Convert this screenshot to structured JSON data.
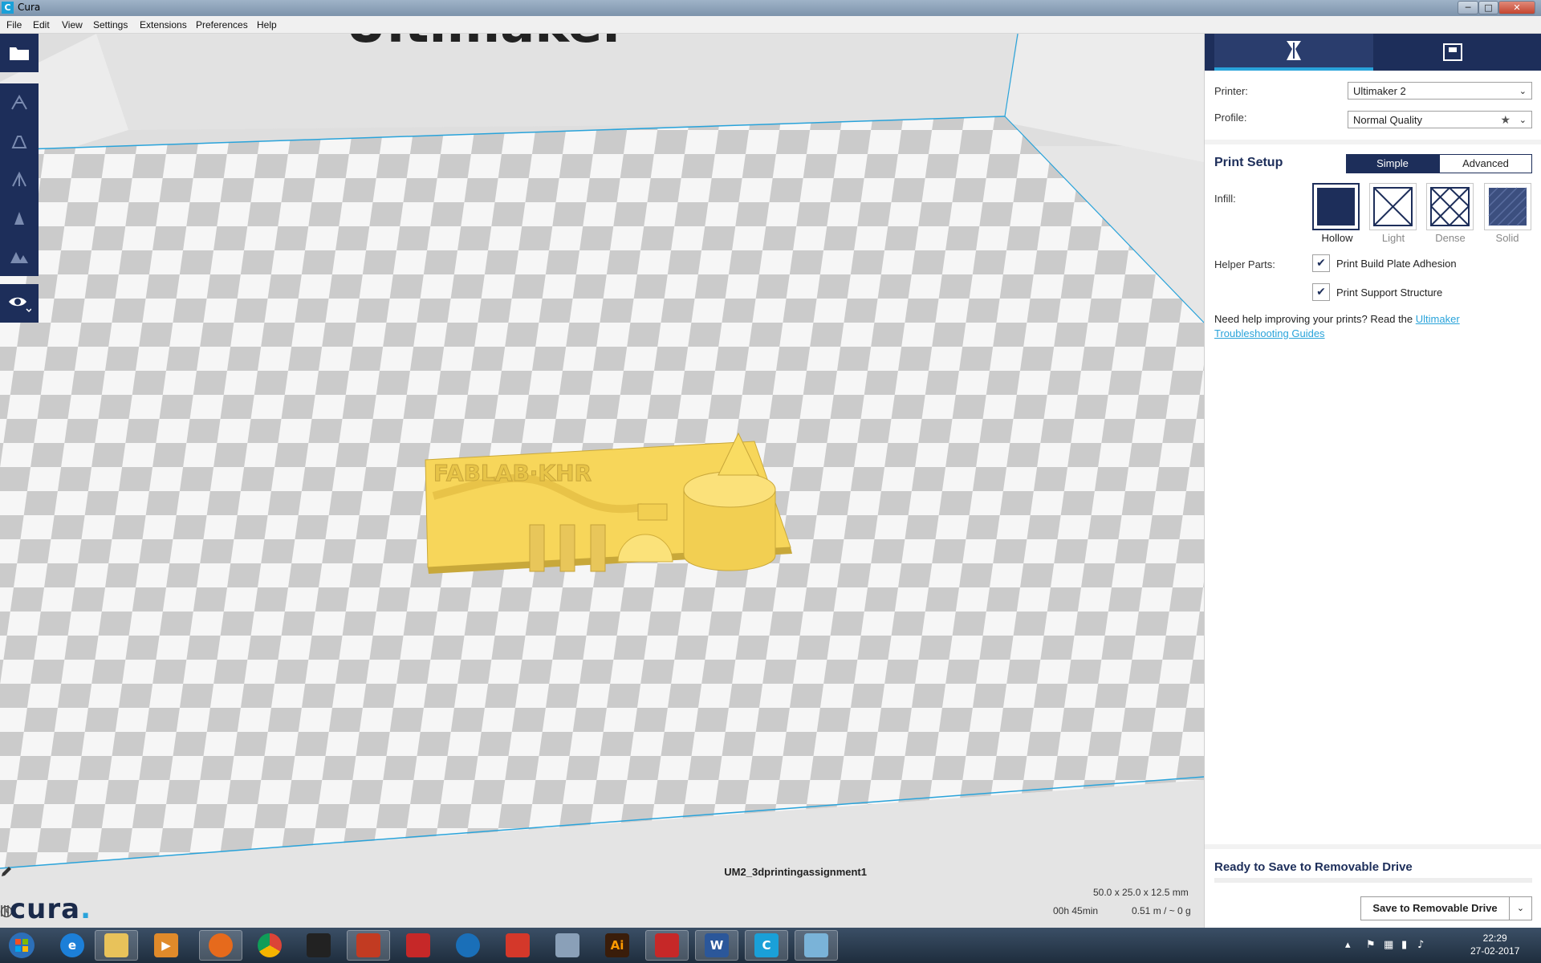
{
  "window": {
    "title": "Cura",
    "app_icon_glyph": "C",
    "min": "─",
    "max": "□",
    "close": "✕"
  },
  "menu": [
    "File",
    "Edit",
    "View",
    "Settings",
    "Extensions",
    "Preferences",
    "Help"
  ],
  "viewport": {
    "build_plate_brand": "Ultimaker",
    "job_name": "UM2_3dprintingassignment1",
    "dimensions": "50.0 x 25.0 x 12.5 mm",
    "print_time": "00h 45min",
    "material": "0.51 m / ~ 0 g",
    "logo_text": "cura",
    "logo_dot": "."
  },
  "left_toolbar": {
    "buttons": [
      "open-file-icon",
      "translate-icon",
      "scale-icon",
      "rotate-icon",
      "mirror-icon",
      "per-object-settings-icon",
      "view-mode-icon"
    ]
  },
  "panel": {
    "tabs": [
      "print-setup-icon",
      "monitor-icon"
    ],
    "printer_label": "Printer:",
    "printer_value": "Ultimaker 2",
    "profile_label": "Profile:",
    "profile_value": "Normal Quality",
    "print_setup_title": "Print Setup",
    "mode_simple": "Simple",
    "mode_advanced": "Advanced",
    "infill_label": "Infill:",
    "infill_options": [
      "Hollow",
      "Light",
      "Dense",
      "Solid"
    ],
    "infill_selected": "Hollow",
    "helper_label": "Helper Parts:",
    "adhesion_label": "Print Build Plate Adhesion",
    "adhesion_checked": true,
    "support_label": "Print Support Structure",
    "support_checked": true,
    "help_text": "Need help improving your prints? Read the ",
    "help_link": "Ultimaker Troubleshooting Guides",
    "ready_text": "Ready to Save to Removable Drive",
    "save_button": "Save to Removable Drive",
    "check_glyph": "✔",
    "chevron_glyph": "⌄"
  },
  "taskbar": {
    "apps": [
      "ie",
      "explorer",
      "media",
      "firefox",
      "chrome",
      "app-a",
      "ccleaner",
      "app-b",
      "app-c",
      "app-d",
      "keyboard",
      "illustrator",
      "app-e",
      "word",
      "cura",
      "paint"
    ],
    "illustrator_label": "Ai",
    "word_label": "W",
    "cura_label": "C",
    "clock_time": "22:29",
    "clock_date": "27-02-2017"
  },
  "colors": {
    "accent": "#29a3da",
    "navy": "#1d2e5a",
    "model": "#f7d65a"
  }
}
